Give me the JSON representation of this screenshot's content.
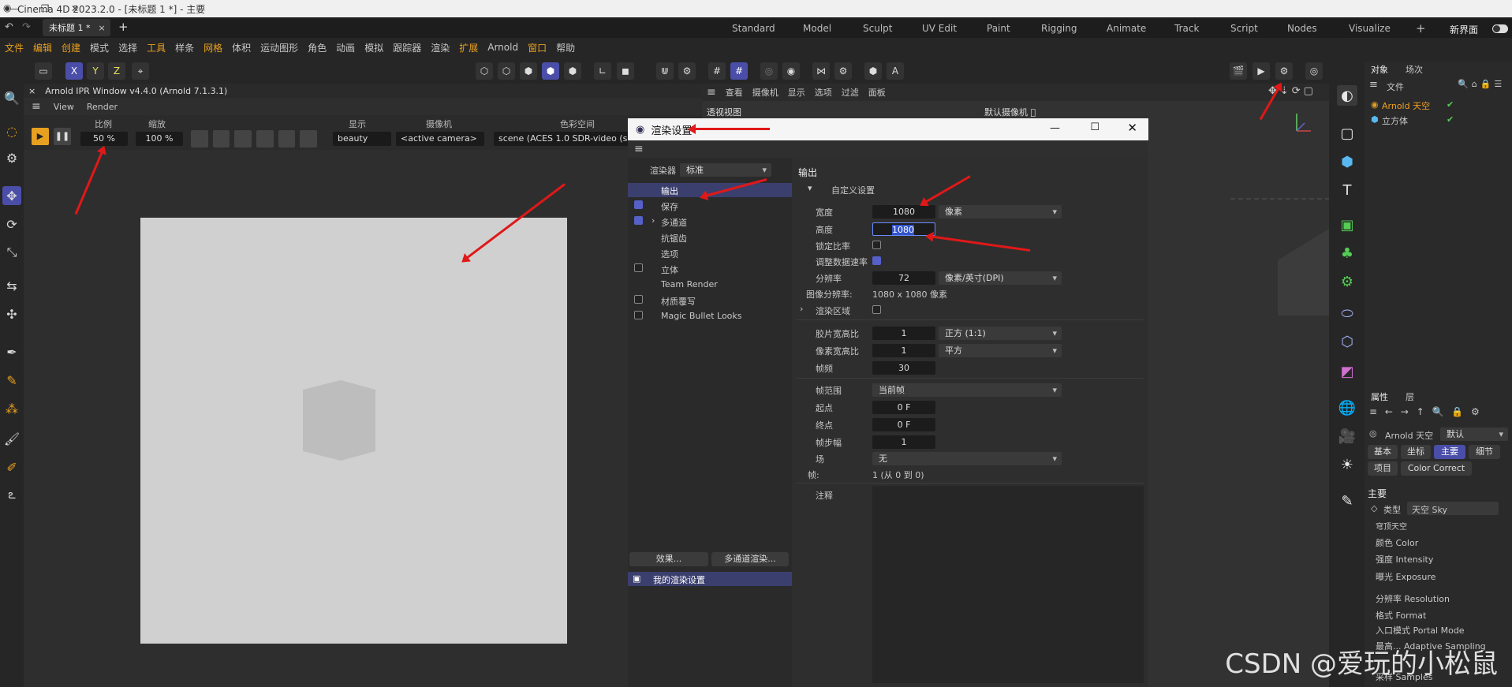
{
  "window": {
    "title": "Cinema 4D 2023.2.0 - [未标题 1 *] - 主要",
    "minimize": "—",
    "restore": "❐",
    "close": "✕"
  },
  "tabs": {
    "doc": "未标题 1 *",
    "close": "×",
    "add": "+"
  },
  "modes": [
    "Standard",
    "Model",
    "Sculpt",
    "UV Edit",
    "Paint",
    "Rigging",
    "Animate",
    "Track",
    "Script",
    "Nodes",
    "Visualize"
  ],
  "mode_add": "+",
  "new_ui": "新界面",
  "menu": [
    "文件",
    "编辑",
    "创建",
    "模式",
    "选择",
    "工具",
    "样条",
    "网格",
    "体积",
    "运动图形",
    "角色",
    "动画",
    "模拟",
    "跟踪器",
    "渲染",
    "扩展",
    "Arnold",
    "窗口",
    "帮助"
  ],
  "axes": {
    "x": "X",
    "y": "Y",
    "z": "Z"
  },
  "ipr": {
    "title": "Arnold IPR Window v4.4.0 (Arnold 7.1.3.1)",
    "close": "×",
    "menu": [
      "View",
      "Render"
    ],
    "ratio_label": "比例",
    "ratio_value": "50 %",
    "zoom_label": "缩放",
    "zoom_value": "100 %",
    "display_label": "显示",
    "display_value": "beauty",
    "camera_label": "摄像机",
    "camera_value": "<active camera>",
    "colorspace_label": "色彩空间",
    "colorspace_value": "scene (ACES 1.0 SDR-video (sR"
  },
  "viewport": {
    "menu": [
      "查看",
      "摄像机",
      "显示",
      "选项",
      "过滤",
      "面板"
    ],
    "name": "透视视图",
    "camera": "默认摄像机 ゚"
  },
  "dialog": {
    "title": "渲染设置",
    "renderer_label": "渲染器",
    "renderer_value": "标准",
    "nav": [
      {
        "label": "输出",
        "checked": null,
        "selected": true
      },
      {
        "label": "保存",
        "checked": true
      },
      {
        "label": "多通道",
        "checked": true,
        "expand": true
      },
      {
        "label": "抗锯齿",
        "checked": null
      },
      {
        "label": "选项",
        "checked": null
      },
      {
        "label": "立体",
        "checked": false
      },
      {
        "label": "Team Render",
        "checked": null
      },
      {
        "label": "材质覆写",
        "checked": false
      },
      {
        "label": "Magic Bullet Looks",
        "checked": false
      }
    ],
    "effects_button": "效果...",
    "multipass_button": "多通道渲染...",
    "preset": "我的渲染设置",
    "output": {
      "heading": "输出",
      "preset": "自定义设置",
      "width_label": "宽度",
      "width": "1080",
      "unit": "像素",
      "height_label": "高度",
      "height": "1080",
      "lock_ratio": "锁定比率",
      "lock_ratio_checked": false,
      "adapt_rate": "调整数据速率",
      "adapt_rate_checked": true,
      "resolution_label": "分辨率",
      "resolution": "72",
      "resolution_unit": "像素/英寸(DPI)",
      "image_res_label": "图像分辨率:",
      "image_res": "1080 x 1080 像素",
      "render_region": "渲染区域",
      "render_region_checked": false,
      "film_aspect_label": "胶片宽高比",
      "film_aspect": "1",
      "film_aspect_mode": "正方 (1:1)",
      "pixel_aspect_label": "像素宽高比",
      "pixel_aspect": "1",
      "pixel_aspect_mode": "平方",
      "fps_label": "帧频",
      "fps": "30",
      "frame_range_label": "帧范围",
      "frame_range": "当前帧",
      "start_label": "起点",
      "start": "0 F",
      "end_label": "终点",
      "end": "0 F",
      "step_label": "帧步幅",
      "step": "1",
      "field_label": "场",
      "field": "无",
      "frames_label": "帧:",
      "frames": "1 (从 0 到 0)",
      "notes_label": "注释"
    }
  },
  "objects": {
    "tabs": [
      "对象",
      "场次"
    ],
    "menu": [
      "文件"
    ],
    "items": [
      {
        "name": "Arnold 天空",
        "color": "#f0a020"
      },
      {
        "name": "立方体",
        "color": "#cfcfcf"
      }
    ]
  },
  "attributes": {
    "tabs": [
      "属性",
      "层"
    ],
    "object": "Arnold 天空",
    "mode": "默认",
    "buttons": [
      "基本",
      "坐标",
      "主要",
      "细节",
      "项目",
      "Color Correct"
    ],
    "active_button": "主要",
    "section": "主要",
    "type_label": "类型",
    "type_value": "天空 Sky",
    "group": "穹顶天空",
    "params": [
      "颜色 Color",
      "强度 Intensity",
      "曝光 Exposure",
      "分辨率 Resolution",
      "格式 Format",
      "入口模式 Portal Mode",
      "最高... Adaptive Sampling",
      "采样 Samples"
    ]
  },
  "watermark": "CSDN @爱玩的小松鼠",
  "accent": "#4a4ea8",
  "annotation_color": "#e01818"
}
